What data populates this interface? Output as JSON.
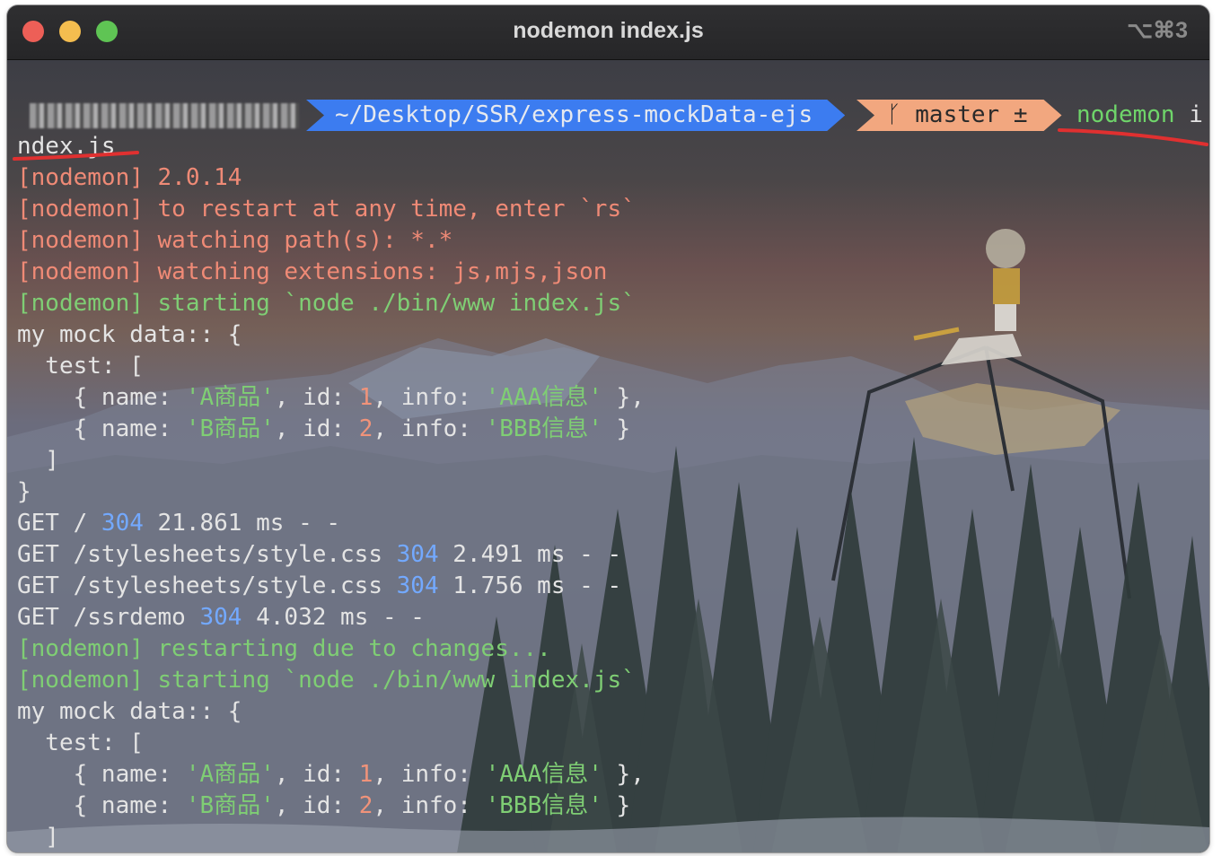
{
  "window": {
    "title": "nodemon index.js",
    "shortcut": "⌥⌘3"
  },
  "prompt": {
    "host": "",
    "path": "~/Desktop/SSR/express-mockData-ejs",
    "branch_icon": "",
    "branch": "master ±",
    "command": "nodemon",
    "command_arg": "i"
  },
  "colors": {
    "path_segment": "#3c7cf0",
    "branch_segment": "#f2a77f",
    "nodemon_info": "#ef8a76",
    "nodemon_status": "#7fce74",
    "status_code": "#73a9ff",
    "annotation": "#e03030"
  },
  "lines": [
    {
      "segs": [
        {
          "c": "white",
          "t": "ndex.js"
        }
      ]
    },
    {
      "segs": [
        {
          "c": "red",
          "t": "[nodemon] 2.0.14"
        }
      ]
    },
    {
      "segs": [
        {
          "c": "red",
          "t": "[nodemon] to restart at any time, enter `rs`"
        }
      ]
    },
    {
      "segs": [
        {
          "c": "red",
          "t": "[nodemon] watching path(s): *.*"
        }
      ]
    },
    {
      "segs": [
        {
          "c": "red",
          "t": "[nodemon] watching extensions: js,mjs,json"
        }
      ]
    },
    {
      "segs": [
        {
          "c": "green",
          "t": "[nodemon] starting `node ./bin/www index.js`"
        }
      ]
    },
    {
      "segs": [
        {
          "c": "white",
          "t": "my mock data:: {"
        }
      ]
    },
    {
      "segs": [
        {
          "c": "white",
          "t": "  test: ["
        }
      ]
    },
    {
      "segs": [
        {
          "c": "white",
          "t": "    { name: "
        },
        {
          "c": "green",
          "t": "'A商品'"
        },
        {
          "c": "white",
          "t": ", id: "
        },
        {
          "c": "num",
          "t": "1"
        },
        {
          "c": "white",
          "t": ", info: "
        },
        {
          "c": "green",
          "t": "'AAA信息'"
        },
        {
          "c": "white",
          "t": " },"
        }
      ]
    },
    {
      "segs": [
        {
          "c": "white",
          "t": "    { name: "
        },
        {
          "c": "green",
          "t": "'B商品'"
        },
        {
          "c": "white",
          "t": ", id: "
        },
        {
          "c": "num",
          "t": "2"
        },
        {
          "c": "white",
          "t": ", info: "
        },
        {
          "c": "green",
          "t": "'BBB信息'"
        },
        {
          "c": "white",
          "t": " }"
        }
      ]
    },
    {
      "segs": [
        {
          "c": "white",
          "t": "  ]"
        }
      ]
    },
    {
      "segs": [
        {
          "c": "white",
          "t": "}"
        }
      ]
    },
    {
      "segs": [
        {
          "c": "white",
          "t": "GET / "
        },
        {
          "c": "blue",
          "t": "304"
        },
        {
          "c": "white",
          "t": " 21.861 ms - -"
        }
      ]
    },
    {
      "segs": [
        {
          "c": "white",
          "t": "GET /stylesheets/style.css "
        },
        {
          "c": "blue",
          "t": "304"
        },
        {
          "c": "white",
          "t": " 2.491 ms - -"
        }
      ]
    },
    {
      "segs": [
        {
          "c": "white",
          "t": "GET /stylesheets/style.css "
        },
        {
          "c": "blue",
          "t": "304"
        },
        {
          "c": "white",
          "t": " 1.756 ms - -"
        }
      ]
    },
    {
      "segs": [
        {
          "c": "white",
          "t": "GET /ssrdemo "
        },
        {
          "c": "blue",
          "t": "304"
        },
        {
          "c": "white",
          "t": " 4.032 ms - -"
        }
      ]
    },
    {
      "segs": [
        {
          "c": "green",
          "t": "[nodemon] restarting due to changes..."
        }
      ]
    },
    {
      "segs": [
        {
          "c": "green",
          "t": "[nodemon] starting `node ./bin/www index.js`"
        }
      ]
    },
    {
      "segs": [
        {
          "c": "white",
          "t": "my mock data:: {"
        }
      ]
    },
    {
      "segs": [
        {
          "c": "white",
          "t": "  test: ["
        }
      ]
    },
    {
      "segs": [
        {
          "c": "white",
          "t": "    { name: "
        },
        {
          "c": "green",
          "t": "'A商品'"
        },
        {
          "c": "white",
          "t": ", id: "
        },
        {
          "c": "num",
          "t": "1"
        },
        {
          "c": "white",
          "t": ", info: "
        },
        {
          "c": "green",
          "t": "'AAA信息'"
        },
        {
          "c": "white",
          "t": " },"
        }
      ]
    },
    {
      "segs": [
        {
          "c": "white",
          "t": "    { name: "
        },
        {
          "c": "green",
          "t": "'B商品'"
        },
        {
          "c": "white",
          "t": ", id: "
        },
        {
          "c": "num",
          "t": "2"
        },
        {
          "c": "white",
          "t": ", info: "
        },
        {
          "c": "green",
          "t": "'BBB信息'"
        },
        {
          "c": "white",
          "t": " }"
        }
      ]
    },
    {
      "segs": [
        {
          "c": "white",
          "t": "  ]"
        }
      ]
    }
  ]
}
